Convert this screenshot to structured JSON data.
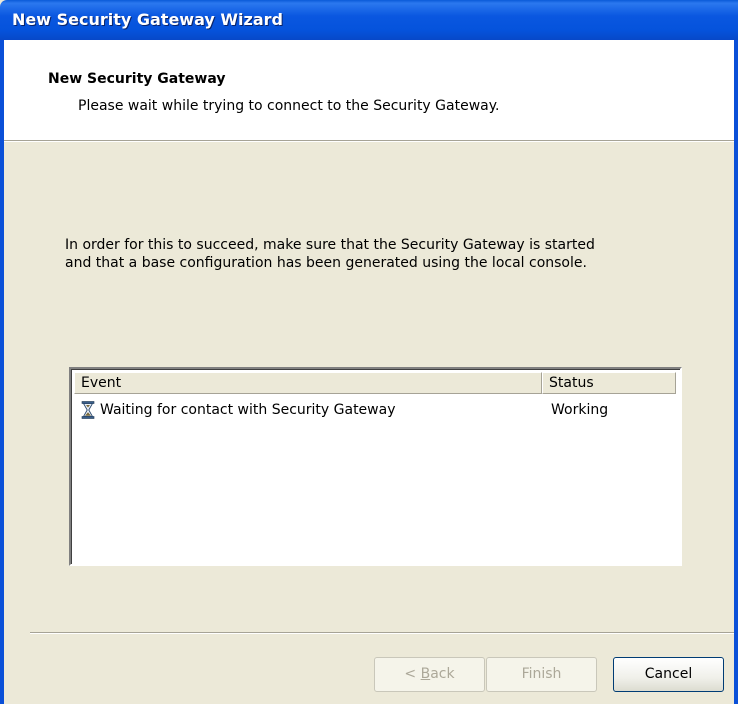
{
  "window": {
    "title": "New Security Gateway Wizard"
  },
  "header": {
    "title": "New Security Gateway",
    "subtitle": "Please wait while trying to connect to the Security Gateway."
  },
  "info": {
    "line1": "In order for this to succeed, make sure that the Security Gateway is started",
    "line2": "and that a base configuration has been generated using the local console."
  },
  "event_list": {
    "columns": {
      "event": "Event",
      "status": "Status"
    },
    "rows": [
      {
        "icon": "hourglass-icon",
        "event": "Waiting for contact with Security Gateway",
        "status": "Working"
      }
    ]
  },
  "buttons": {
    "back_prefix": "< ",
    "back_accel": "B",
    "back_rest": "ack",
    "finish": "Finish",
    "cancel": "Cancel"
  },
  "colors": {
    "titlebar": "#0a57e0",
    "dialog_bg": "#ECE9D8",
    "disabled_text": "#aca899"
  }
}
